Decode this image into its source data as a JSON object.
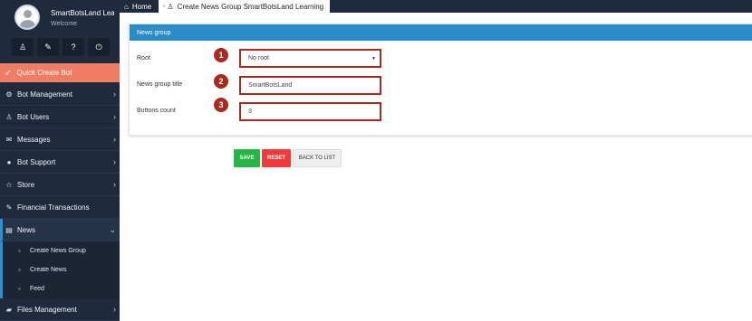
{
  "user": {
    "name": "SmartBotsLand Learning",
    "welcome": "Welcome"
  },
  "quick_buttons": [
    {
      "icon": "user-icon",
      "glyph": "♙"
    },
    {
      "icon": "document-icon",
      "glyph": "✎"
    },
    {
      "icon": "help-icon",
      "glyph": "?"
    },
    {
      "icon": "power-icon",
      "glyph": "⏻"
    }
  ],
  "quick_create": {
    "label": "Quick Create Bot",
    "icon": "rocket-icon"
  },
  "menu": {
    "bot_management": "Bot Management",
    "bot_users": "Bot Users",
    "messages": "Messages",
    "bot_support": "Bot Support",
    "store": "Store",
    "financial_transactions": "Financial Transactions",
    "news": "News",
    "files_management": "Files Management"
  },
  "news_submenu": [
    "Create News Group",
    "Create News",
    "Feed"
  ],
  "tabs": {
    "home": "Home",
    "create": "Create News Group SmartBotsLand Learning",
    "close": "x"
  },
  "panel": {
    "title": "News group",
    "root_label": "Root",
    "root_value": "No root",
    "title_label": "News group title",
    "title_value": "SmartBotsLand",
    "buttons_label": "Buttons count",
    "buttons_value": "3"
  },
  "badges": [
    "1",
    "2",
    "3"
  ],
  "actions": {
    "save": "SAVE",
    "reset": "RESET",
    "back": "BACK TO LIST"
  },
  "colors": {
    "accent": "#2a8bc6",
    "quick_create": "#f07c64",
    "badge": "#a8291e",
    "save": "#27b545",
    "reset": "#ef3b3b",
    "sidebar": "#1f2a3c"
  }
}
